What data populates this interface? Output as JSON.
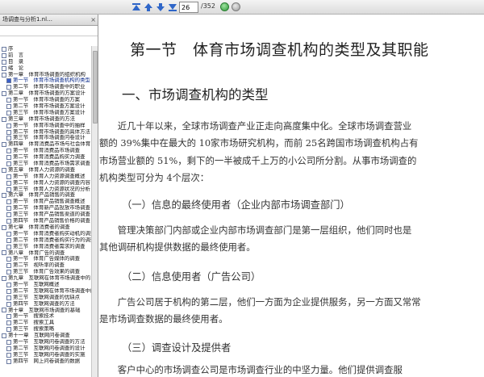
{
  "toolbar": {
    "page_value": "26",
    "page_total": "/352"
  },
  "sidebar": {
    "tab_label": "场调查与分析1.nl…",
    "items": [
      {
        "level": 0,
        "text": "序"
      },
      {
        "level": 0,
        "text": "前　言"
      },
      {
        "level": 0,
        "text": "目　录"
      },
      {
        "level": 0,
        "text": "绪　论"
      },
      {
        "level": 0,
        "text": "第一章　体育市场调查的组织机构"
      },
      {
        "level": 1,
        "text": "第一节　体育市场调查机构的类型",
        "selected": true
      },
      {
        "level": 1,
        "text": "第二节　体育市场调查中的职业"
      },
      {
        "level": 0,
        "text": "第二章　体育市场调查的方案设计"
      },
      {
        "level": 1,
        "text": "第一节　体育市场调查的方案"
      },
      {
        "level": 1,
        "text": "第二节　体育市场调查方案设计"
      },
      {
        "level": 1,
        "text": "第三节　体育市场调查方案设计"
      },
      {
        "level": 0,
        "text": "第三章　体育市场调查的方法"
      },
      {
        "level": 1,
        "text": "第一节　体育市场调查中的抽样"
      },
      {
        "level": 1,
        "text": "第二节　体育市场调查的具体方法"
      },
      {
        "level": 1,
        "text": "第三节　体育市场调查问卷设计"
      },
      {
        "level": 0,
        "text": "第四章　体育消费品市场与社会体育"
      },
      {
        "level": 1,
        "text": "第一节　体育消费品市场调查"
      },
      {
        "level": 1,
        "text": "第二节　体育消费品购买力调查"
      },
      {
        "level": 1,
        "text": "第三节　体育消费品市场需求调查"
      },
      {
        "level": 0,
        "text": "第五章　体育人力资源的调查"
      },
      {
        "level": 1,
        "text": "第一节　体育人力资源调查概述"
      },
      {
        "level": 1,
        "text": "第二节　体育人力资源的调查内容"
      },
      {
        "level": 1,
        "text": "第三节　体育人力资源状况的分析"
      },
      {
        "level": 0,
        "text": "第六章　体育产品销售的调查"
      },
      {
        "level": 1,
        "text": "第一节　体育产品销售调查概述"
      },
      {
        "level": 1,
        "text": "第二节　体育新产品投放市场调查"
      },
      {
        "level": 1,
        "text": "第三节　体育产品销售渠道的调查"
      },
      {
        "level": 1,
        "text": "第四节　体育产品销售价格的调查"
      },
      {
        "level": 0,
        "text": "第七章　体育消费者的调查"
      },
      {
        "level": 1,
        "text": "第一节　体育消费者购买动机的调查"
      },
      {
        "level": 1,
        "text": "第二节　体育消费者购买行为的调查"
      },
      {
        "level": 1,
        "text": "第三节　体育消费者需求的调查"
      },
      {
        "level": 0,
        "text": "第八章　体育广告的调查"
      },
      {
        "level": 1,
        "text": "第一节　体育广告媒体的调查"
      },
      {
        "level": 1,
        "text": "第二节　视听率的调查"
      },
      {
        "level": 1,
        "text": "第三节　体育广告效果的调查"
      },
      {
        "level": 0,
        "text": "第九章　互联网在体育市场调查中的"
      },
      {
        "level": 1,
        "text": "第一节　互联网概述"
      },
      {
        "level": 1,
        "text": "第二节　互联网在体育市场调查中的"
      },
      {
        "level": 1,
        "text": "第三节　互联网调查的优缺点"
      },
      {
        "level": 1,
        "text": "第四节　互联网调查的方法"
      },
      {
        "level": 0,
        "text": "第十章　互联网市场调查的基础"
      },
      {
        "level": 1,
        "text": "第一节　搜索技术"
      },
      {
        "level": 1,
        "text": "第二节　搜索工具"
      },
      {
        "level": 1,
        "text": "第三节　搜索策略"
      },
      {
        "level": 0,
        "text": "第十一章　互联网问卷调查"
      },
      {
        "level": 1,
        "text": "第一节　互联网问卷调查的方法"
      },
      {
        "level": 1,
        "text": "第二节　互联网问卷调查的设计"
      },
      {
        "level": 1,
        "text": "第三节　互联网问卷调查的实施"
      },
      {
        "level": 1,
        "text": "第四节　网上问卷调查的数据"
      }
    ]
  },
  "document": {
    "title": "第一节　体育市场调查机构的类型及其职能",
    "heading1": "一、市场调查机构的类型",
    "para1": [
      "　　近几十年以来，全球市场调查产业正走向高度集中化。全球市场调查营业",
      "额的 39%集中在最大的 10家市场研究机构，而前 25名跨国市场调查机构占有",
      "市场营业额的 51%，剩下的一半被成千上万的小公司所分割。从事市场调查的",
      "机构类型可分为 4个层次："
    ],
    "heading2a": "（一）信息的最终使用者（企业内部市场调查部门）",
    "para2": [
      "　　管理决策部门内部或企业内部市场调查部门是第一层组织，他们同时也是",
      "其他调研机构提供数据的最终使用者。"
    ],
    "heading2b": "（二）信息使用者（广告公司）",
    "para3": [
      "　　广告公司居于机构的第二层，他们一方面为企业提供服务，另一方面又常常",
      "是市场调查数据的最终使用者。"
    ],
    "heading2c": "（三）调查设计及提供者",
    "para4": [
      "　　客户中心的市场调查公司是市场调查行业的中坚力量。他们提供调查服"
    ]
  },
  "colors": {
    "toolbar_arrow": "#2f66c8",
    "selected_item": "#3b5fc8"
  }
}
